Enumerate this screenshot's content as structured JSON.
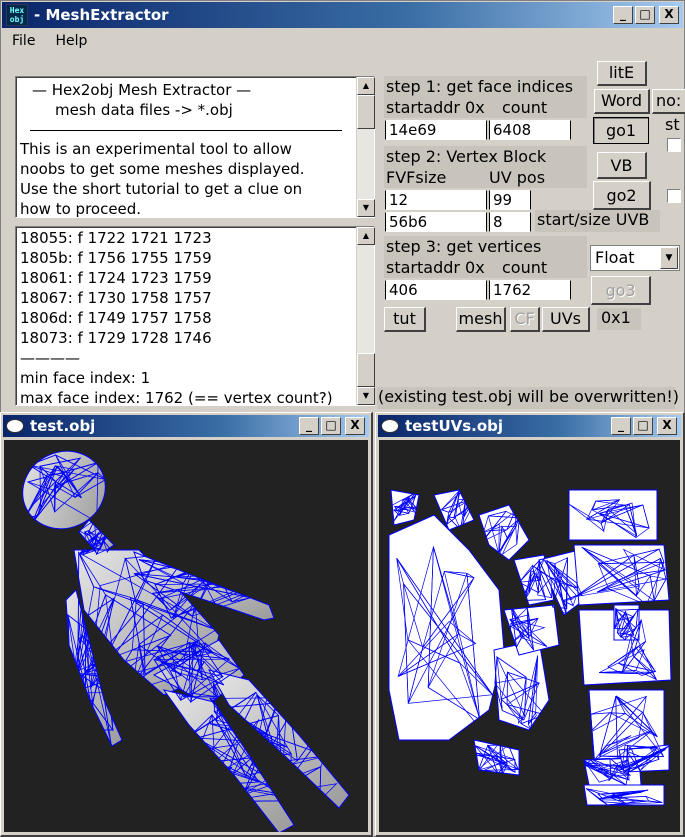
{
  "window": {
    "title": "- MeshExtractor",
    "icon_text": "Hex obj",
    "min_label": "_",
    "max_label": "□",
    "close_label": "X"
  },
  "menu": {
    "file": "File",
    "help": "Help"
  },
  "info_box": {
    "lines": [
      "—   Hex2obj Mesh Extractor   —",
      "mesh data files -> *.obj",
      "This is an experimental tool to allow",
      "noobs to get some meshes displayed.",
      "Use the short tutorial to get a clue on",
      "how to proceed."
    ]
  },
  "log_box": {
    "lines": [
      "18055: f  1722 1721 1723",
      "1805b: f  1756 1755 1759",
      "18061: f  1724 1723 1759",
      "18067: f  1730 1758 1757",
      "1806d: f  1749 1757 1758",
      "18073: f  1729 1728 1746",
      "————",
      "min face index: 1",
      "max face index: 1762 (== vertex count?)"
    ]
  },
  "step1": {
    "title": "step 1: get face indices",
    "addr_label": "startaddr 0x",
    "count_label": "count",
    "addr_value": "14e69",
    "count_value": "6408",
    "go_label": "go1"
  },
  "step2": {
    "title": "step 2: Vertex Block",
    "fvf_label": "FVFsize",
    "uvpos_label": "UV pos",
    "fvf_value": "12",
    "uvpos_value": "99",
    "uvb_start": "56b6",
    "uvb_size": "8",
    "uvb_label": "start/size UVB",
    "go_label": "go2",
    "vb_label": "VB"
  },
  "step3": {
    "title": "step 3: get vertices",
    "addr_label": "startaddr 0x",
    "count_label": "count",
    "addr_value": "406",
    "count_value": "1762",
    "go_label": "go3",
    "type_value": "Float"
  },
  "buttons": {
    "lite": "litE",
    "word": "Word",
    "tut": "tut",
    "mesh": "mesh",
    "cf": "CF",
    "uvs": "UVs",
    "hex_value": "0x1",
    "clip_no": "no:",
    "clip_st": "st"
  },
  "status_text": "(existing test.obj will be overwritten!)",
  "mesh_window": {
    "title": "test.obj"
  },
  "uv_window": {
    "title": "testUVs.obj"
  },
  "colors": {
    "wire": "#0000ff",
    "mesh_fill": "#cfcfcf",
    "canvas_bg": "#222222",
    "titlebar": "#0a246a"
  }
}
